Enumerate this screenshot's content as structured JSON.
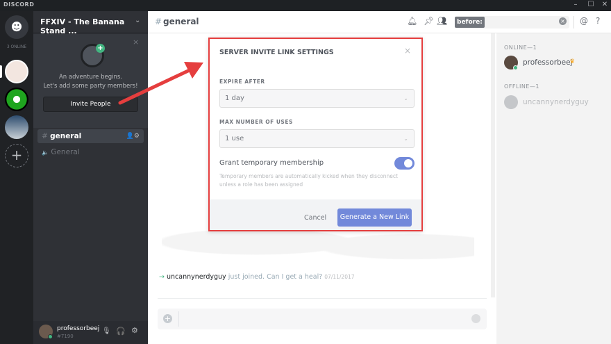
{
  "app": {
    "brand": "DISCORD",
    "window_controls": [
      "–",
      "☐",
      "✕"
    ]
  },
  "servers": {
    "online_count": "3 ONLINE",
    "add_label": "+"
  },
  "server": {
    "name": "FFXIV - The Banana Stand ...",
    "invite_line1": "An adventure begins.",
    "invite_line2": "Let's add some party members!",
    "invite_button": "Invite People"
  },
  "channels": [
    {
      "prefix": "#",
      "name": "general"
    },
    {
      "prefix": "🔈",
      "name": "General"
    }
  ],
  "user": {
    "name": "professorbeej",
    "tag": "#7190"
  },
  "header": {
    "channel_prefix": "#",
    "channel": "general",
    "search_token": "before:"
  },
  "members": {
    "online_header": "ONLINE—1",
    "offline_header": "OFFLINE—1",
    "online": [
      {
        "name": "professorbeej",
        "crown": "♛"
      }
    ],
    "offline": [
      {
        "name": "uncannynerdyguy"
      }
    ]
  },
  "modal": {
    "title": "SERVER INVITE LINK SETTINGS",
    "expire_label": "EXPIRE AFTER",
    "expire_value": "1 day",
    "uses_label": "MAX NUMBER OF USES",
    "uses_value": "1 use",
    "temp_label": "Grant temporary membership",
    "temp_desc": "Temporary members are automatically kicked when they disconnect unless a role has been assigned",
    "temp_enabled": true,
    "cancel": "Cancel",
    "generate": "Generate a New Link"
  },
  "message": {
    "user": "uncannynerdyguy",
    "text": "just joined. Can I get a heal?",
    "time": "07/11/2017"
  },
  "colors": {
    "accent": "#7289da",
    "highlight": "#e53e3e",
    "online": "#43b581"
  }
}
